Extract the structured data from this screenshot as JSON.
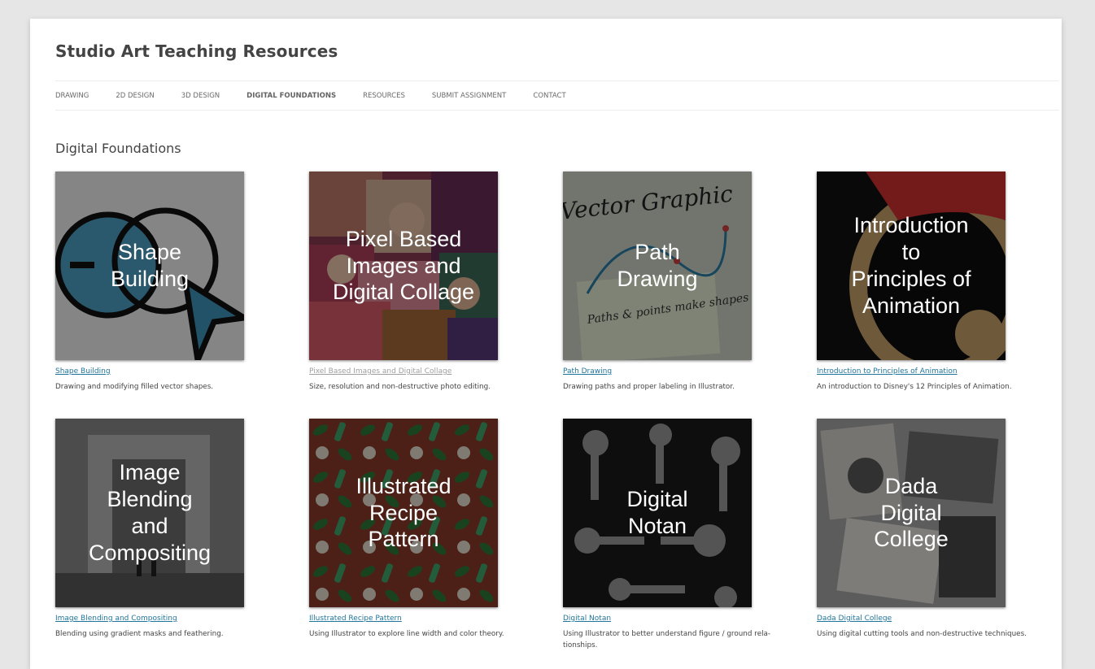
{
  "site": {
    "title": "Studio Art Teaching Resources"
  },
  "nav": {
    "items": [
      "DRAWING",
      "2D DESIGN",
      "3D DESIGN",
      "DIGITAL FOUNDATIONS",
      "RESOURCES",
      "SUBMIT ASSIGNMENT",
      "CONTACT"
    ],
    "active": "DIGITAL FOUNDATIONS"
  },
  "section": {
    "title": "Digital Foundations"
  },
  "cards": [
    {
      "thumb_label": "Shape\nBuilding",
      "link": "Shape Building",
      "description": "Drawing and modifying filled vector shapes."
    },
    {
      "thumb_label": "Pixel Based\nImages and\nDigital Collage",
      "link": "Pixel Based Images and Digital Collage",
      "description": "Size, resolution and non-destructive photo editing."
    },
    {
      "thumb_label": "Path\nDrawing",
      "link": "Path Drawing",
      "description": "Drawing paths and proper labeling in Illustrator."
    },
    {
      "thumb_label": "Introduction\nto\nPrinciples of\nAnimation",
      "link": "Introduction to Principles of Animation",
      "description": "An introduction to Disney's 12 Principles of Animation."
    },
    {
      "thumb_label": "Image\nBlending\nand\nCompositing",
      "link": "Image Blending and Compositing",
      "description": "Blending using gradient masks and feathering."
    },
    {
      "thumb_label": "Illustrated\nRecipe\nPattern",
      "link": "Illustrated Recipe Pattern",
      "description": "Using Illustrator to explore line width and color theory."
    },
    {
      "thumb_label": "Digital\nNotan",
      "link": "Digital Notan",
      "description": "Using Illustrator to better understand figure / ground rela-tionships."
    },
    {
      "thumb_label": "Dada\nDigital\nCollege",
      "link": "Dada Digital College",
      "description": "Using digital cutting tools and non-destructive techniques."
    }
  ],
  "thumb_decor": {
    "path_drawing_text": "Vector Graphic",
    "path_drawing_note": "Paths & points make shapes"
  },
  "colors": {
    "link": "#21759b",
    "visited_link": "#9f9f9f",
    "page_bg": "#e6e6e6"
  }
}
